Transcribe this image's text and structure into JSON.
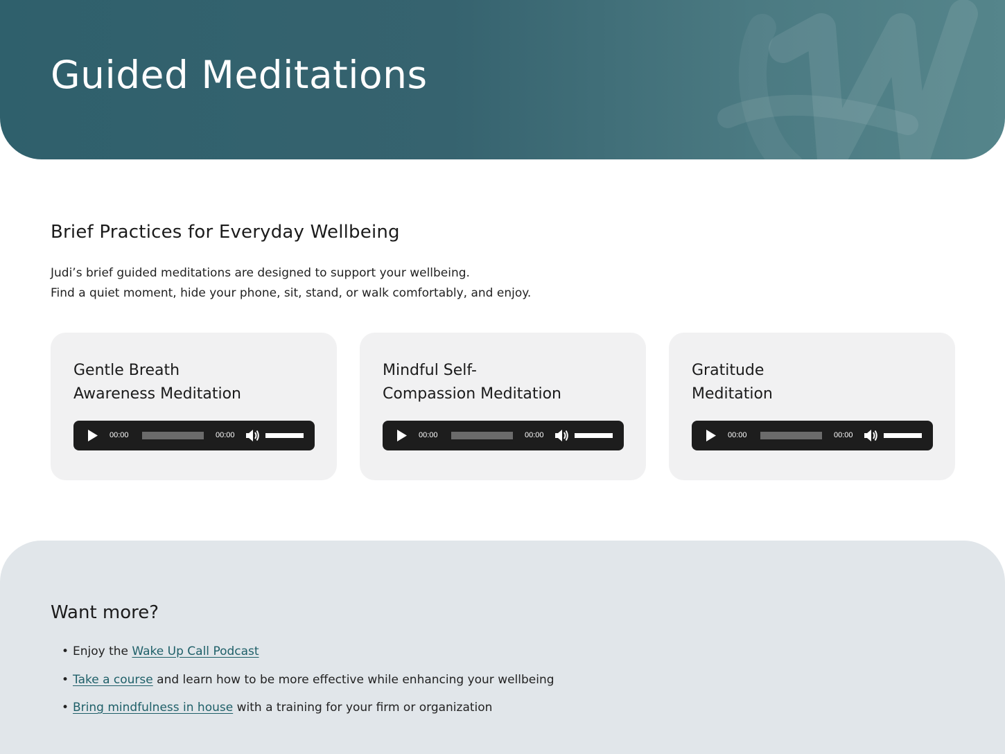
{
  "hero": {
    "title": "Guided Meditations"
  },
  "section": {
    "heading": "Brief Practices for Everyday Wellbeing",
    "intro_line1": "Judi’s brief guided meditations are designed to support your wellbeing.",
    "intro_line2": "Find a quiet moment, hide your phone, sit, stand, or walk comfortably, and enjoy."
  },
  "cards": [
    {
      "title_line1": "Gentle Breath",
      "title_line2": "Awareness Meditation",
      "current_time": "00:00",
      "duration": "00:00"
    },
    {
      "title_line1": "Mindful Self-",
      "title_line2": "Compassion Meditation",
      "current_time": "00:00",
      "duration": "00:00"
    },
    {
      "title_line1": "Gratitude",
      "title_line2": "Meditation",
      "current_time": "00:00",
      "duration": "00:00"
    }
  ],
  "more": {
    "heading": "Want more?",
    "items": [
      {
        "prefix": "Enjoy the ",
        "link": "Wake Up Call Podcast",
        "suffix": ""
      },
      {
        "prefix": "",
        "link": "Take a course",
        "suffix": " and learn how to be more effective while enhancing your wellbeing"
      },
      {
        "prefix": "",
        "link": "Bring mindfulness in house",
        "suffix": " with a training for your firm or organization"
      }
    ]
  },
  "icons": [
    "play-icon",
    "volume-icon",
    "brand-watermark"
  ],
  "colors": {
    "hero": "#36636f",
    "link": "#1e5f68",
    "card_bg": "#f1f1f2",
    "player_bg": "#1d1d1d",
    "footer_bg": "#e1e6ea"
  }
}
